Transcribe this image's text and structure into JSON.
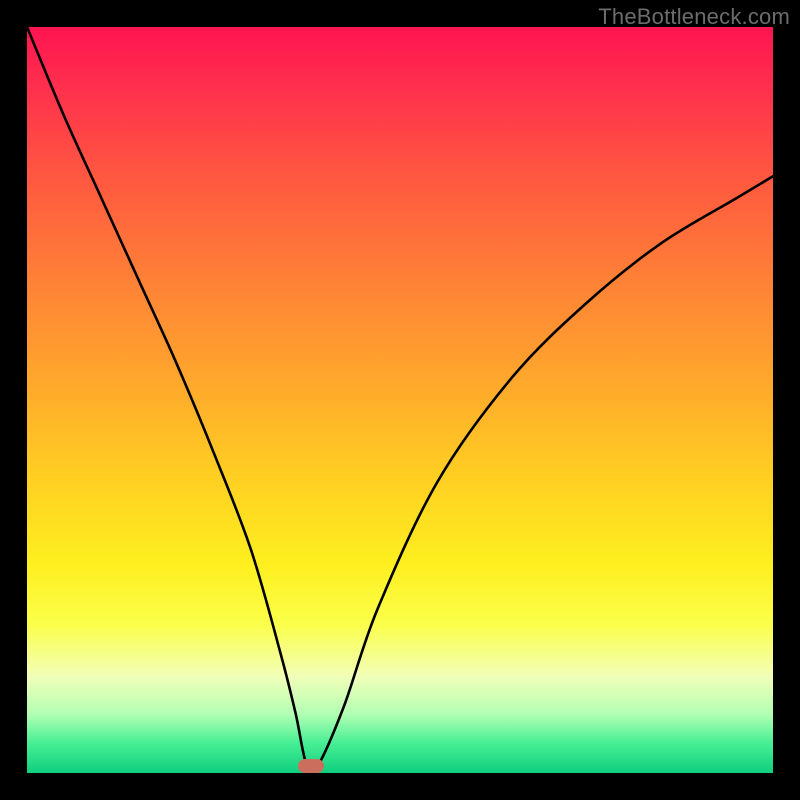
{
  "watermark": "TheBottleneck.com",
  "chart_data": {
    "type": "line",
    "title": "",
    "xlabel": "",
    "ylabel": "",
    "xlim": [
      0,
      100
    ],
    "ylim": [
      0,
      100
    ],
    "grid": false,
    "series": [
      {
        "name": "bottleneck-curve",
        "x": [
          0,
          5,
          10,
          15,
          20,
          25,
          30,
          34,
          36,
          37.5,
          39,
          42.5,
          47,
          55,
          65,
          75,
          85,
          95,
          100
        ],
        "values": [
          100,
          88,
          77,
          66,
          55,
          43,
          30,
          16,
          8,
          1,
          1,
          9,
          22,
          39,
          53,
          63,
          71,
          77,
          80
        ]
      }
    ],
    "annotations": [
      {
        "name": "min-marker",
        "x": 38,
        "y": 1
      }
    ],
    "gradient_stops": [
      {
        "pos": 0,
        "color": "#ff1450"
      },
      {
        "pos": 20,
        "color": "#ff5740"
      },
      {
        "pos": 47,
        "color": "#ffa62c"
      },
      {
        "pos": 72,
        "color": "#feef1f"
      },
      {
        "pos": 92,
        "color": "#b4ffb4"
      },
      {
        "pos": 100,
        "color": "#0fce7e"
      }
    ]
  }
}
